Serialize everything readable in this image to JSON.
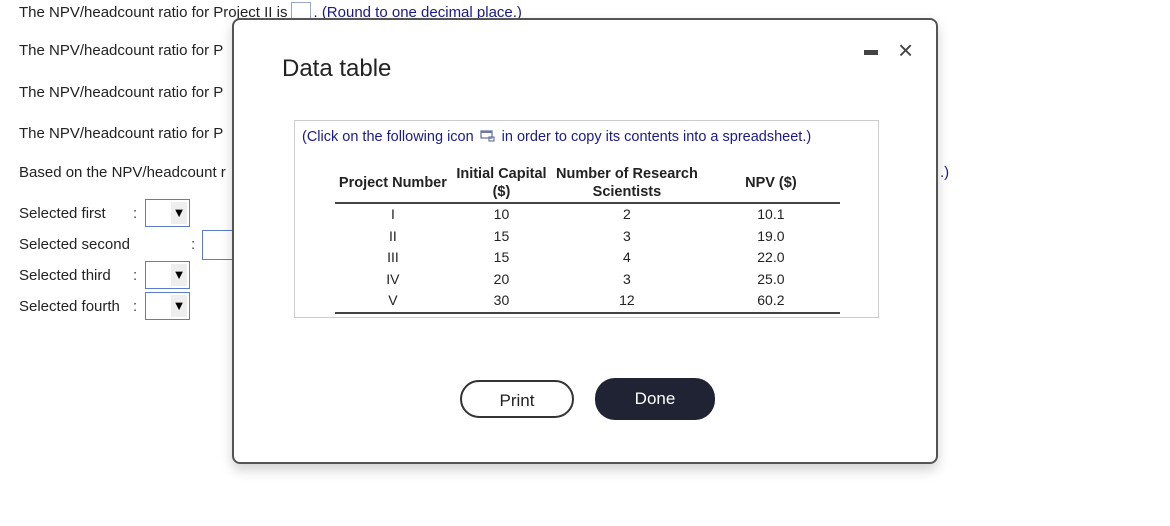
{
  "question": {
    "line1_prefix": "The NPV/headcount ratio for Project II is",
    "line1_suffix": ".",
    "line1_hint": "(Round to one decimal place.)",
    "line2": "The NPV/headcount ratio for P",
    "line3": "The NPV/headcount ratio for P",
    "line4": "The NPV/headcount ratio for P",
    "line5": "Based on the NPV/headcount r",
    "line5_tail": ".)",
    "selections": [
      {
        "label": "Selected first",
        "value": ""
      },
      {
        "label": "Selected second",
        "value": ""
      },
      {
        "label": "Selected third",
        "value": ""
      },
      {
        "label": "Selected fourth",
        "value": ""
      }
    ],
    "colon": ":",
    "dropdown_arrow": "▼"
  },
  "dialog": {
    "title": "Data table",
    "minimize_icon": "minimize-icon",
    "close_icon": "×",
    "copy_note_before": "(Click on the following icon",
    "copy_note_after": "in order to copy its contents into a spreadsheet.)",
    "table": {
      "headers": [
        "Project Number",
        "Initial Capital ($)",
        "Number of Research Scientists",
        "NPV ($)"
      ],
      "rows": [
        [
          "I",
          "10",
          "2",
          "10.1"
        ],
        [
          "II",
          "15",
          "3",
          "19.0"
        ],
        [
          "III",
          "15",
          "4",
          "22.0"
        ],
        [
          "IV",
          "20",
          "3",
          "25.0"
        ],
        [
          "V",
          "30",
          "12",
          "60.2"
        ]
      ]
    },
    "print_label": "Print",
    "done_label": "Done"
  }
}
